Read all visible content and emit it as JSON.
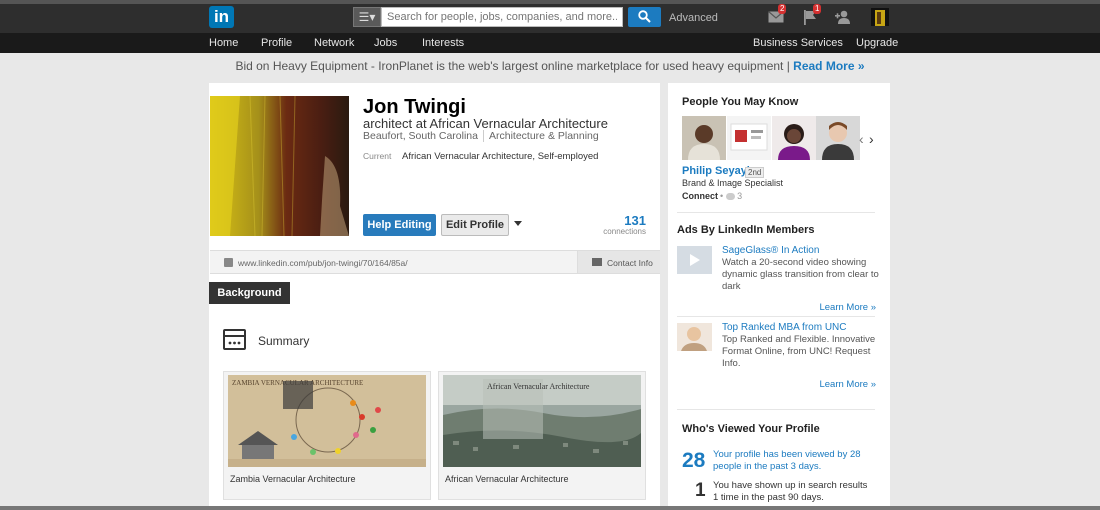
{
  "topbar": {
    "logo_text": "in",
    "search_placeholder": "Search for people, jobs, companies, and more...",
    "advanced_label": "Advanced",
    "messages_count": "2",
    "notifications_count": "1"
  },
  "nav": {
    "items": [
      "Home",
      "Profile",
      "Network",
      "Jobs",
      "Interests"
    ],
    "right_items": [
      "Business Services",
      "Upgrade"
    ]
  },
  "adline": {
    "text": "Bid on Heavy Equipment - IronPlanet is the web's largest online marketplace for used heavy equipment | ",
    "link": "Read More »"
  },
  "profile": {
    "name": "Jon Twingi",
    "headline": "architect at African Vernacular Architecture",
    "location": "Beaufort, South Carolina",
    "industry": "Architecture & Planning",
    "current_label": "Current",
    "current_value": "African Vernacular Architecture, Self-employed",
    "help_editing_label": "Help Editing",
    "edit_profile_label": "Edit Profile",
    "connections_count": "131",
    "connections_label": "connections",
    "public_url": "www.linkedin.com/pub/jon-twingi/70/164/85a/",
    "contact_info_label": "Contact Info"
  },
  "background": {
    "tab_label": "Background",
    "summary_title": "Summary",
    "media": [
      {
        "caption": "Zambia Vernacular Architecture",
        "overlay": "ZAMBIA VERNACULAR ARCHITECTURE"
      },
      {
        "caption": "African Vernacular Architecture",
        "overlay": "African Vernacular Architecture"
      }
    ]
  },
  "sidebar": {
    "pymk_title": "People You May Know",
    "pymk_person_name": "Philip Seyayi",
    "pymk_person_degree": "2nd",
    "pymk_person_title": "Brand & Image Specialist",
    "pymk_connect": "Connect",
    "pymk_shared_count": "3",
    "ads_title": "Ads By LinkedIn Members",
    "ads": [
      {
        "title": "SageGlass® In Action",
        "body": "Watch a 20-second video showing dynamic glass transition from clear to dark",
        "learn": "Learn More »"
      },
      {
        "title": "Top Ranked MBA from UNC",
        "body": "Top Ranked and Flexible. Innovative Format Online, from UNC! Request Info.",
        "learn": "Learn More »"
      }
    ],
    "wvyp_title": "Who's Viewed Your Profile",
    "wvyp_views_count": "28",
    "wvyp_views_text": "Your profile has been viewed by 28 people in the past 3 days.",
    "wvyp_search_count": "1",
    "wvyp_search_text": "You have shown up in search results 1 time in the past 90 days."
  },
  "colors": {
    "brand_blue": "#0077b5",
    "link_blue": "#1c7bc0",
    "badge_red": "#d53131"
  }
}
